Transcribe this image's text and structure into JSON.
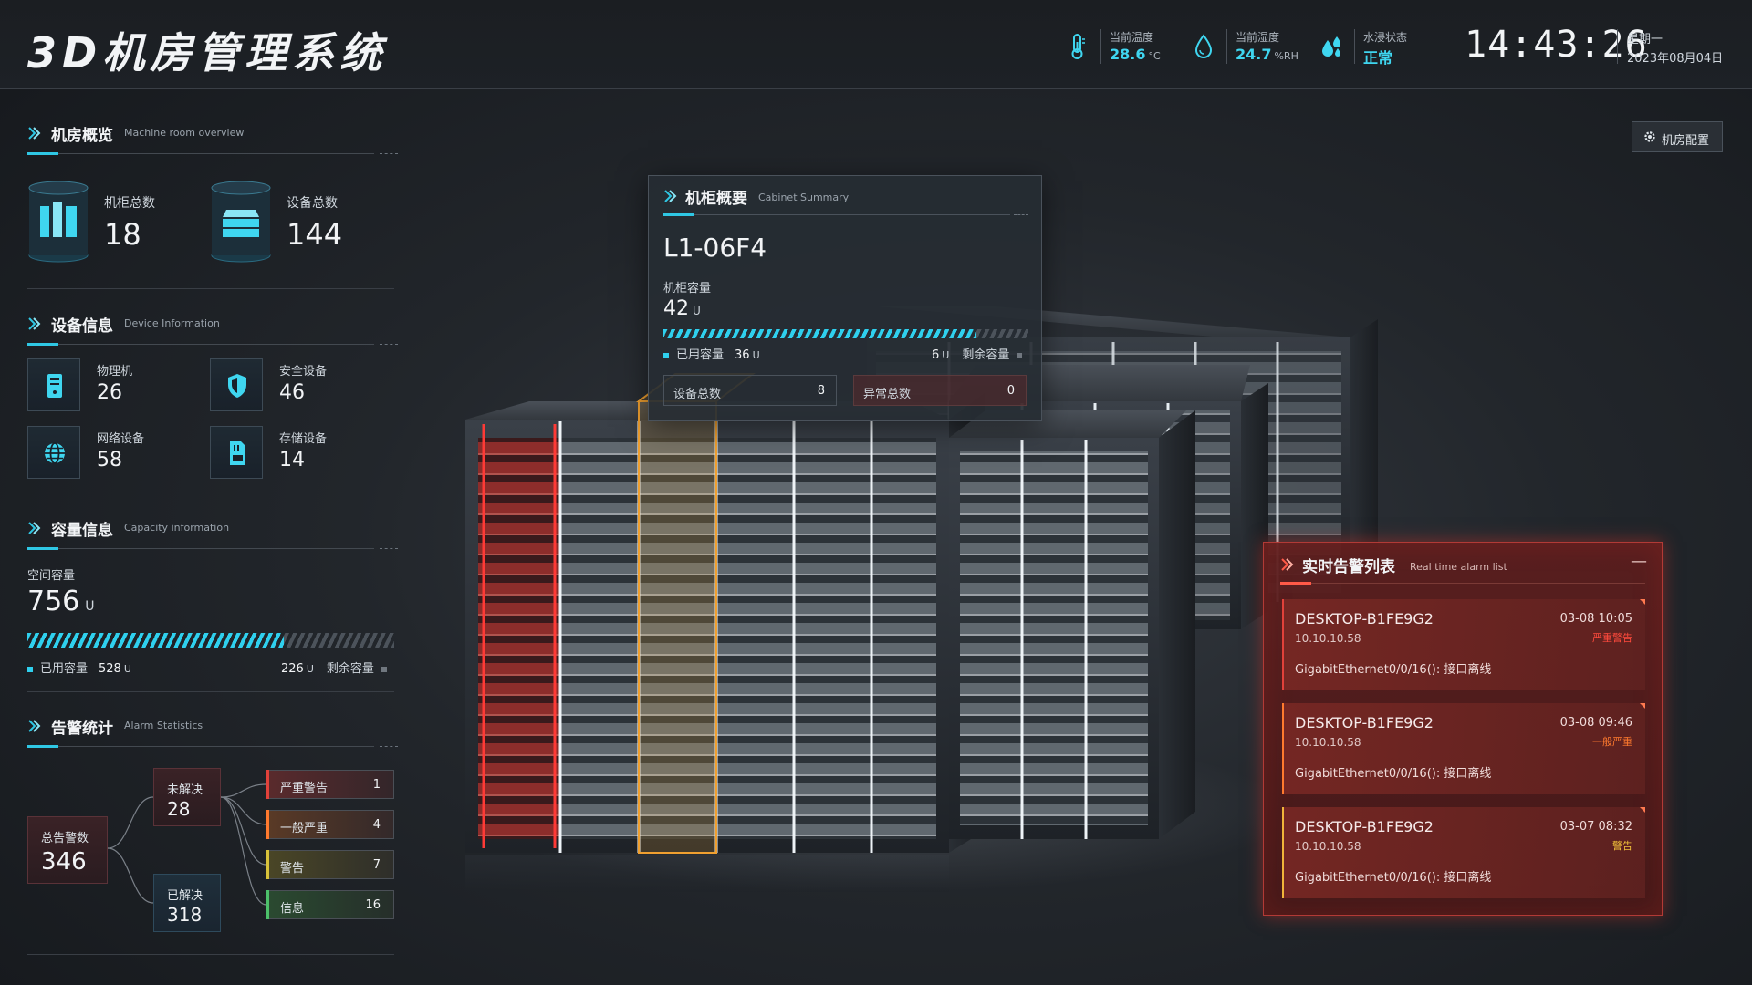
{
  "app": {
    "title": "3D机房管理系统"
  },
  "env": {
    "temperature": {
      "label": "当前温度",
      "value": "28.6",
      "unit": "°C"
    },
    "humidity": {
      "label": "当前湿度",
      "value": "24.7",
      "unit": "%RH"
    },
    "water": {
      "label": "水浸状态",
      "value": "正常"
    },
    "time": "14:43:26",
    "weekday": "星期一",
    "date": "2023年08月04日"
  },
  "overview": {
    "title": "机房概览",
    "subtitle": "Machine room overview",
    "cabinets_label": "机柜总数",
    "cabinets_value": "18",
    "devices_label": "设备总数",
    "devices_value": "144"
  },
  "device_info": {
    "title": "设备信息",
    "subtitle": "Device Information",
    "items": [
      {
        "label": "物理机",
        "value": "26",
        "icon": "server-icon"
      },
      {
        "label": "安全设备",
        "value": "46",
        "icon": "shield-icon"
      },
      {
        "label": "网络设备",
        "value": "58",
        "icon": "globe-icon"
      },
      {
        "label": "存储设备",
        "value": "14",
        "icon": "storage-card-icon"
      }
    ]
  },
  "capacity": {
    "title": "容量信息",
    "subtitle": "Capacity information",
    "space_label": "空间容量",
    "space_value": "756",
    "unit": "U",
    "used_label": "已用容量",
    "used_value": "528",
    "remaining_label": "剩余容量",
    "remaining_value": "226",
    "used_fraction": 0.7
  },
  "alarm_stats": {
    "title": "告警统计",
    "subtitle": "Alarm Statistics",
    "total_label": "总告警数",
    "total_value": "346",
    "unresolved_label": "未解决",
    "unresolved_value": "28",
    "resolved_label": "已解决",
    "resolved_value": "318",
    "levels": [
      {
        "label": "严重警告",
        "value": "1",
        "color": "#e1413a"
      },
      {
        "label": "一般严重",
        "value": "4",
        "color": "#ff7a2e"
      },
      {
        "label": "警告",
        "value": "7",
        "color": "#d8c23a"
      },
      {
        "label": "信息",
        "value": "16",
        "color": "#4cc06a"
      }
    ]
  },
  "cabinet_summary": {
    "title": "机柜概要",
    "subtitle": "Cabinet Summary",
    "id": "L1-06F4",
    "capacity_label": "机柜容量",
    "capacity_value": "42",
    "unit": "U",
    "used_label": "已用容量",
    "used_value": "36",
    "remaining_label": "剩余容量",
    "remaining_value": "6",
    "used_fraction": 0.857,
    "device_total_label": "设备总数",
    "device_total_value": "8",
    "abnormal_label": "异常总数",
    "abnormal_value": "0"
  },
  "config_button": {
    "label": "机房配置"
  },
  "realtime_alarms": {
    "title": "实时告警列表",
    "subtitle": "Real time alarm list",
    "minimize_label": "—",
    "items": [
      {
        "host": "DESKTOP-B1FE9G2",
        "ip": "10.10.10.58",
        "time": "03-08  10:05",
        "level": "严重警告",
        "level_color": "#ff4a3c",
        "message": "GigabitEthernet0/0/16(): 接口离线"
      },
      {
        "host": "DESKTOP-B1FE9G2",
        "ip": "10.10.10.58",
        "time": "03-08  09:46",
        "level": "一般严重",
        "level_color": "#ff7a2e",
        "message": "GigabitEthernet0/0/16(): 接口离线"
      },
      {
        "host": "DESKTOP-B1FE9G2",
        "ip": "10.10.10.58",
        "time": "03-07  08:32",
        "level": "警告",
        "level_color": "#f0c03a",
        "message": "GigabitEthernet0/0/16(): 接口离线"
      }
    ]
  },
  "colors": {
    "accent": "#2fc7e4",
    "alarm": "#e1413a",
    "selected_cabinet": "#f0a030"
  }
}
